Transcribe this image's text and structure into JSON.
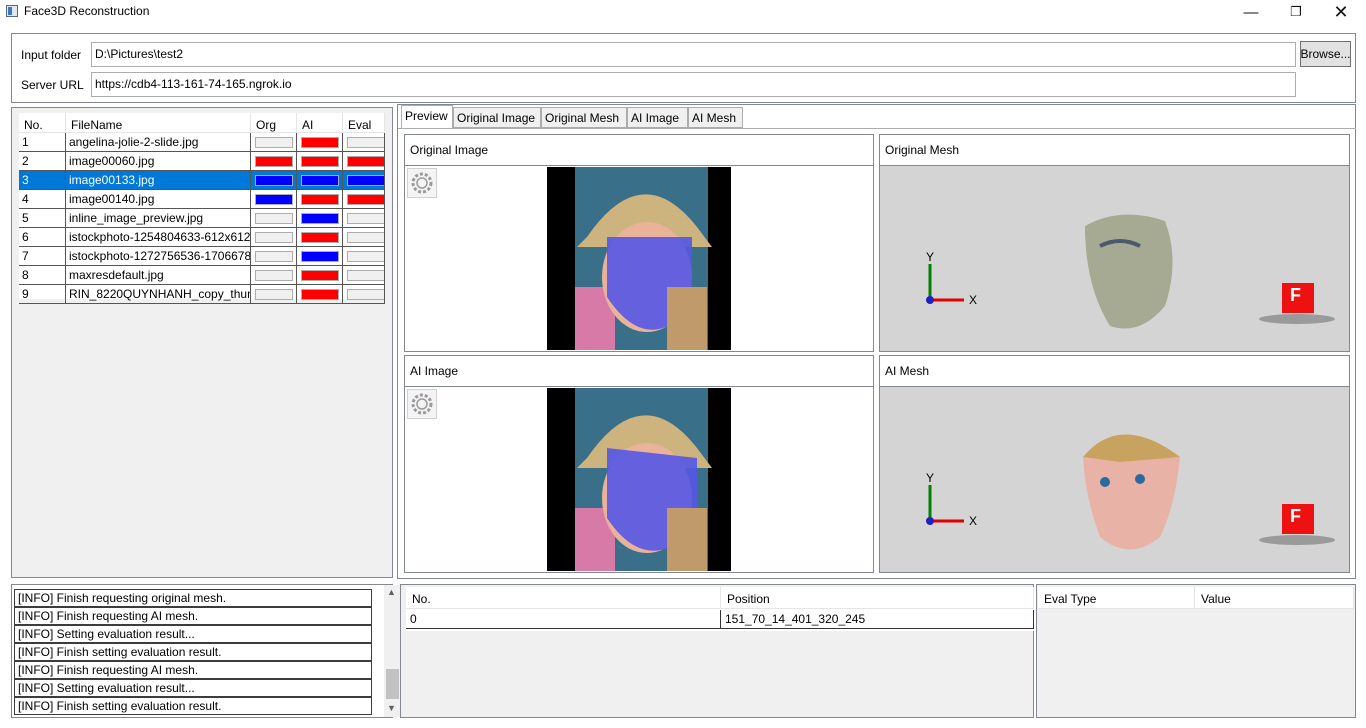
{
  "window": {
    "title": "Face3D Reconstruction",
    "minimize_glyph": "—",
    "maximize_glyph": "❐",
    "close_glyph": "✕"
  },
  "settings": {
    "input_folder_label": "Input folder",
    "input_folder_value": "D:\\Pictures\\test2",
    "browse_label": "Browse...",
    "server_url_label": "Server URL",
    "server_url_value": "https://cdb4-113-161-74-165.ngrok.io"
  },
  "filelist": {
    "columns": [
      "No.",
      "FileName",
      "Org",
      "AI",
      "Eval"
    ],
    "rows": [
      {
        "no": "1",
        "name": "angelina-jolie-2-slide.jpg",
        "org": "#f0f0f0",
        "ai": "#ff0000",
        "eval": "#f0f0f0"
      },
      {
        "no": "2",
        "name": "image00060.jpg",
        "org": "#ff0000",
        "ai": "#ff0000",
        "eval": "#ff0000"
      },
      {
        "no": "3",
        "name": "image00133.jpg",
        "org": "#0000ff",
        "ai": "#0000ff",
        "eval": "#0000ff"
      },
      {
        "no": "4",
        "name": "image00140.jpg",
        "org": "#0000ff",
        "ai": "#ff0000",
        "eval": "#ff0000"
      },
      {
        "no": "5",
        "name": "inline_image_preview.jpg",
        "org": "#f0f0f0",
        "ai": "#0000ff",
        "eval": "#f0f0f0"
      },
      {
        "no": "6",
        "name": "istockphoto-1254804633-612x612",
        "org": "#f0f0f0",
        "ai": "#ff0000",
        "eval": "#f0f0f0"
      },
      {
        "no": "7",
        "name": "istockphoto-1272756536-1706678",
        "org": "#f0f0f0",
        "ai": "#0000ff",
        "eval": "#f0f0f0"
      },
      {
        "no": "8",
        "name": "maxresdefault.jpg",
        "org": "#f0f0f0",
        "ai": "#ff0000",
        "eval": "#f0f0f0"
      },
      {
        "no": "9",
        "name": "RIN_8220QUYNHANH_copy_thum",
        "org": "#f0f0f0",
        "ai": "#ff0000",
        "eval": "#f0f0f0"
      }
    ],
    "selected_index": 2
  },
  "tabs": [
    "Preview",
    "Original Image",
    "Original Mesh",
    "AI Image",
    "AI Mesh"
  ],
  "panels": {
    "original_image": "Original Image",
    "original_mesh": "Original Mesh",
    "ai_image": "AI Image",
    "ai_mesh": "AI Mesh"
  },
  "axes": {
    "y": "Y",
    "x": "X"
  },
  "view_cube_label": "F",
  "log": [
    "[INFO] Finish requesting original mesh.",
    "[INFO] Finish requesting AI mesh.",
    "[INFO] Setting evaluation result...",
    "[INFO] Finish setting evaluation result.",
    "[INFO] Finish requesting AI mesh.",
    "[INFO] Setting evaluation result...",
    "[INFO] Finish setting evaluation result."
  ],
  "positions": {
    "columns": [
      "No.",
      "Position"
    ],
    "rows": [
      {
        "no": "0",
        "position": "151_70_14_401_320_245"
      }
    ]
  },
  "eval": {
    "columns": [
      "Eval Type",
      "Value"
    ]
  },
  "colors": {
    "selection": "#0078d7",
    "fail": "#ff0000",
    "pass": "#0000ff",
    "empty": "#f0f0f0"
  }
}
